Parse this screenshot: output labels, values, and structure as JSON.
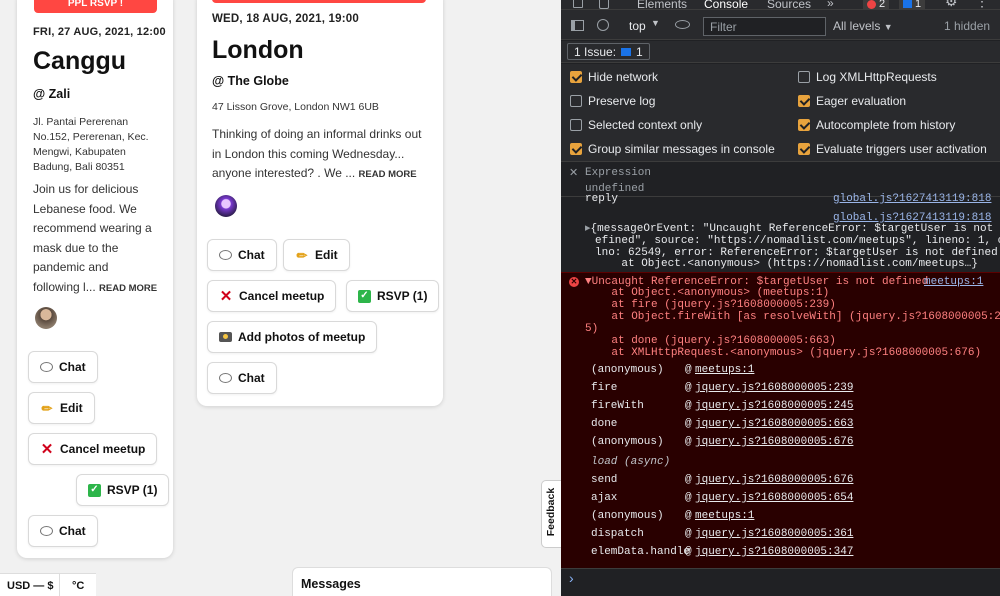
{
  "left_card": {
    "rsvp_banner": "PPL RSVP !",
    "date": "FRI, 27 AUG, 2021, 12:00",
    "city": "Canggu",
    "venue": "@ Zali",
    "address_lines": [
      "Jl. Pantai Pererenan",
      "No.152, Pererenan, Kec.",
      "Mengwi, Kabupaten",
      "Badung, Bali 80351"
    ],
    "description_lines": [
      "Join us for delicious",
      "Lebanese food. We",
      "recommend wearing a",
      "mask due to the",
      "pandemic and",
      "following l..."
    ],
    "read_more": "READ MORE",
    "buttons": {
      "chat": "Chat",
      "edit": "Edit",
      "cancel": "Cancel meetup",
      "rsvp": "RSVP (1)",
      "chat2": "Chat"
    }
  },
  "mid_card": {
    "date": "WED, 18 AUG, 2021, 19:00",
    "city": "London",
    "venue": "@ The Globe",
    "address": "47 Lisson Grove, London NW1 6UB",
    "description_lines": [
      "Thinking of doing an informal drinks out",
      "in London this coming Wednesday...",
      "anyone interested? . We ..."
    ],
    "read_more": "READ MORE",
    "buttons": {
      "chat": "Chat",
      "edit": "Edit",
      "cancel": "Cancel meetup",
      "rsvp": "RSVP (1)",
      "photos": "Add photos of meetup",
      "chat2": "Chat"
    }
  },
  "bottom": {
    "currency": "USD — $",
    "temp": "°C",
    "messages": "Messages",
    "feedback": "Feedback"
  },
  "devtools": {
    "tabs": [
      "Elements",
      "Console",
      "Sources",
      "»"
    ],
    "error_count": "2",
    "msg_count": "1",
    "context": "top",
    "filter_placeholder": "Filter",
    "levels": "All levels",
    "hidden": "1 hidden",
    "issues": "1 Issue:",
    "issues_count": "1",
    "settings": [
      {
        "label": "Hide network",
        "checked": true
      },
      {
        "label": "Log XMLHttpRequests",
        "checked": false
      },
      {
        "label": "Preserve log",
        "checked": false
      },
      {
        "label": "Eager evaluation",
        "checked": true
      },
      {
        "label": "Selected context only",
        "checked": false
      },
      {
        "label": "Autocomplete from history",
        "checked": true
      },
      {
        "label": "Group similar messages in console",
        "checked": true
      },
      {
        "label": "Evaluate triggers user activation",
        "checked": true
      }
    ],
    "expression_label": "Expression",
    "expression_value": "undefined",
    "log_cut_left": "reply",
    "log_cut_right": "global.js?1627413119:818",
    "log_src": "global.js?1627413119:818",
    "log_lines": [
      "{messageOrEvent: \"Uncaught ReferenceError: $targetUser is not d",
      "efined\", source: \"https://nomadlist.com/meetups\", lineno: 1, co",
      "lno: 62549, error: ReferenceError: $targetUser is not defined",
      "    at Object.<anonymous> (https://nomadlist.com/meetups…}"
    ],
    "error_head": "▼Uncaught ReferenceError: $targetUser is not defined",
    "error_src": "meetups:1",
    "error_lines": [
      "    at Object.<anonymous> (meetups:1)",
      "    at fire (jquery.js?1608000005:239)",
      "    at Object.fireWith [as resolveWith] (jquery.js?1608000005:24",
      "5)",
      "    at done (jquery.js?1608000005:663)",
      "    at XMLHttpRequest.<anonymous> (jquery.js?1608000005:676)"
    ],
    "stack": [
      {
        "fn": "(anonymous)",
        "src": "meetups:1"
      },
      {
        "fn": "fire",
        "src": "jquery.js?1608000005:239"
      },
      {
        "fn": "fireWith",
        "src": "jquery.js?1608000005:245"
      },
      {
        "fn": "done",
        "src": "jquery.js?1608000005:663"
      },
      {
        "fn": "(anonymous)",
        "src": "jquery.js?1608000005:676"
      },
      {
        "fn": "load (async)",
        "src": ""
      },
      {
        "fn": "send",
        "src": "jquery.js?1608000005:676"
      },
      {
        "fn": "ajax",
        "src": "jquery.js?1608000005:654"
      },
      {
        "fn": "(anonymous)",
        "src": "meetups:1"
      },
      {
        "fn": "dispatch",
        "src": "jquery.js?1608000005:361"
      },
      {
        "fn": "elemData.handle",
        "src": "jquery.js?1608000005:347"
      }
    ],
    "prompt": "›"
  }
}
